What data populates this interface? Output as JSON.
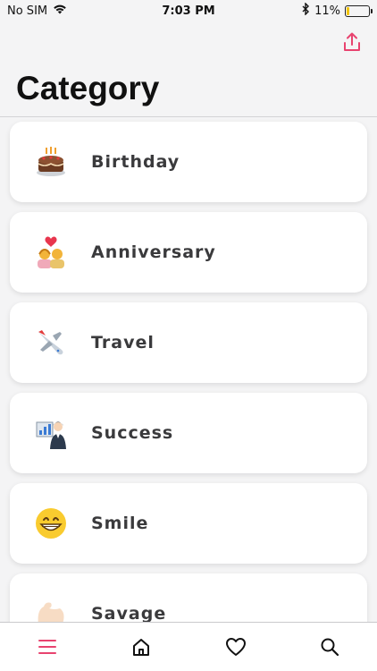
{
  "status_bar": {
    "carrier": "No SIM",
    "time": "7:03 PM",
    "battery_percent_label": "11%",
    "battery_level": 0.11
  },
  "header": {
    "title": "Category",
    "share_icon": "share-icon"
  },
  "categories": [
    {
      "label": "Birthday",
      "icon": "birthday-cake-icon"
    },
    {
      "label": "Anniversary",
      "icon": "couple-with-heart-icon"
    },
    {
      "label": "Travel",
      "icon": "airplane-icon"
    },
    {
      "label": "Success",
      "icon": "presenter-icon"
    },
    {
      "label": "Smile",
      "icon": "grinning-face-icon"
    },
    {
      "label": "Savage",
      "icon": "flexed-biceps-icon"
    }
  ],
  "tab_bar": {
    "tabs": [
      "menu-icon",
      "home-icon",
      "heart-icon",
      "search-icon"
    ],
    "active_index": 0
  },
  "colors": {
    "accent": "#e8436f",
    "card_text": "#3a3a3c",
    "battery": "#f2c400"
  }
}
